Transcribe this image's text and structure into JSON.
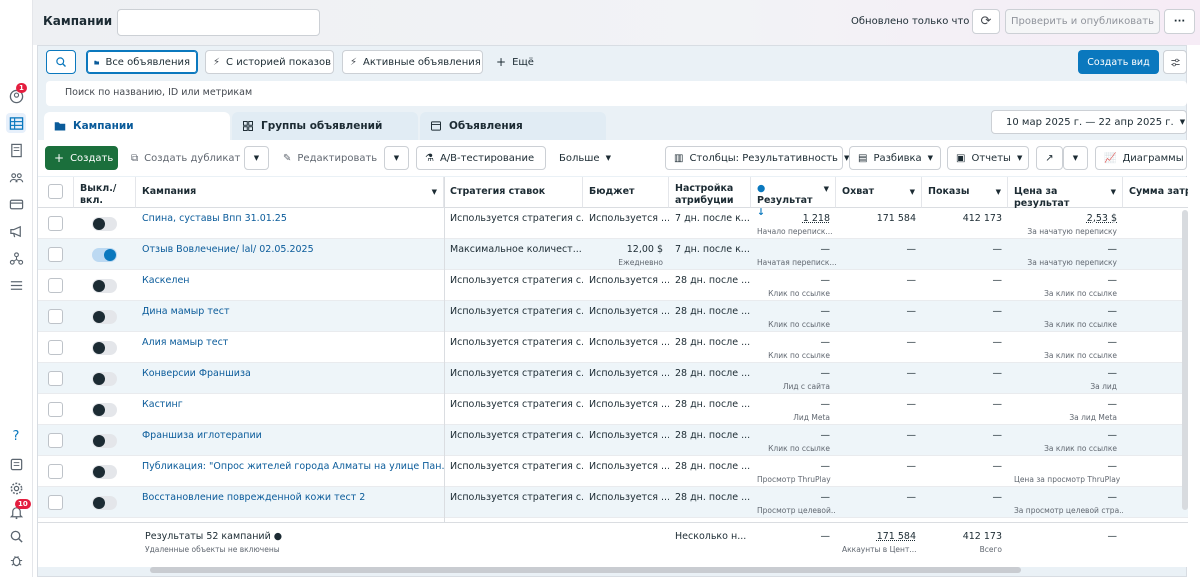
{
  "header": {
    "title": "Кампании",
    "updated": "Обновлено только что",
    "publish": "Проверить и опубликовать",
    "more": "···"
  },
  "views": {
    "all": "Все объявления",
    "history": "С историей показов",
    "active": "Активные объявления",
    "more": "Ещё",
    "create_view": "Создать вид"
  },
  "search": {
    "placeholder": "Поиск по названию, ID или метрикам"
  },
  "tabs": {
    "campaigns": "Кампании",
    "adsets": "Группы объявлений",
    "ads": "Объявления"
  },
  "date_range": "10 мар 2025 г. — 22 апр 2025 г.",
  "toolbar": {
    "create": "Создать",
    "duplicate": "Создать дубликат",
    "edit": "Редактировать",
    "ab": "A/B-тестирование",
    "more": "Больше",
    "columns": "Столбцы: Результативность",
    "breakdown": "Разбивка",
    "reports": "Отчеты",
    "charts": "Диаграммы"
  },
  "columns": {
    "toggle": "Выкл./ вкл.",
    "campaign": "Кампания",
    "bid": "Стратегия ставок",
    "budget": "Бюджет",
    "attribution": "Настройка атрибуции",
    "result": "Результат",
    "reach": "Охват",
    "impressions": "Показы",
    "cpr": "Цена за результат",
    "spent": "Сумма затра"
  },
  "rows": [
    {
      "on": false,
      "name": "Спина, суставы Впп 31.01.25",
      "bid": "Используется стратегия с...",
      "budget": "Используется ...",
      "budget_sub": "",
      "attr": "7 дн. после к...",
      "result": "1 218",
      "result_sub": "Начало переписк...",
      "reach": "171 584",
      "impr": "412 173",
      "cpr": "2,53 $",
      "cpr_sub": "За начатую переписку"
    },
    {
      "on": true,
      "name": "Отзыв Вовлечение/ lal/ 02.05.2025",
      "bid": "Максимальное количест...",
      "budget": "12,00 $",
      "budget_sub": "Ежедневно",
      "attr": "7 дн. после к...",
      "result": "—",
      "result_sub": "Начатая переписк...",
      "reach": "—",
      "impr": "—",
      "cpr": "—",
      "cpr_sub": "За начатую переписку"
    },
    {
      "on": false,
      "name": "Каскелен",
      "bid": "Используется стратегия с...",
      "budget": "Используется ...",
      "budget_sub": "",
      "attr": "28 дн. после ...",
      "result": "—",
      "result_sub": "Клик по ссылке",
      "reach": "—",
      "impr": "—",
      "cpr": "—",
      "cpr_sub": "За клик по ссылке"
    },
    {
      "on": false,
      "name": "Дина мамыр тест",
      "bid": "Используется стратегия с...",
      "budget": "Используется ...",
      "budget_sub": "",
      "attr": "28 дн. после ...",
      "result": "—",
      "result_sub": "Клик по ссылке",
      "reach": "—",
      "impr": "—",
      "cpr": "—",
      "cpr_sub": "За клик по ссылке"
    },
    {
      "on": false,
      "name": "Алия мамыр тест",
      "bid": "Используется стратегия с...",
      "budget": "Используется ...",
      "budget_sub": "",
      "attr": "28 дн. после ...",
      "result": "—",
      "result_sub": "Клик по ссылке",
      "reach": "—",
      "impr": "—",
      "cpr": "—",
      "cpr_sub": "За клик по ссылке"
    },
    {
      "on": false,
      "name": "Конверсии Франшиза",
      "bid": "Используется стратегия с...",
      "budget": "Используется ...",
      "budget_sub": "",
      "attr": "28 дн. после ...",
      "result": "—",
      "result_sub": "Лид с сайта",
      "reach": "—",
      "impr": "—",
      "cpr": "—",
      "cpr_sub": "За лид"
    },
    {
      "on": false,
      "name": "Кастинг",
      "bid": "Используется стратегия с...",
      "budget": "Используется ...",
      "budget_sub": "",
      "attr": "28 дн. после ...",
      "result": "—",
      "result_sub": "Лид Meta",
      "reach": "—",
      "impr": "—",
      "cpr": "—",
      "cpr_sub": "За лид Meta"
    },
    {
      "on": false,
      "name": "Франшиза иглотерапии",
      "bid": "Используется стратегия с...",
      "budget": "Используется ...",
      "budget_sub": "",
      "attr": "28 дн. после ...",
      "result": "—",
      "result_sub": "Клик по ссылке",
      "reach": "—",
      "impr": "—",
      "cpr": "—",
      "cpr_sub": "За клик по ссылке"
    },
    {
      "on": false,
      "name": "Публикация: \"Опрос жителей города Алматы на улице Пан...",
      "bid": "Используется стратегия с...",
      "budget": "Используется ...",
      "budget_sub": "",
      "attr": "28 дн. после ...",
      "result": "—",
      "result_sub": "Просмотр ThruPlay",
      "reach": "—",
      "impr": "—",
      "cpr": "—",
      "cpr_sub": "Цена за просмотр ThruPlay"
    },
    {
      "on": false,
      "name": "Восстановление поврежденной кожи тест 2",
      "bid": "Используется стратегия с...",
      "budget": "Используется ...",
      "budget_sub": "",
      "attr": "28 дн. после ...",
      "result": "—",
      "result_sub": "Просмотр целевой...",
      "reach": "—",
      "impr": "—",
      "cpr": "—",
      "cpr_sub": "За просмотр целевой стра..."
    }
  ],
  "footer": {
    "title": "Результаты 52 кампаний",
    "sub": "Удаленные объекты не включены",
    "attr": "Несколько н...",
    "result": "—",
    "reach": "171 584",
    "reach_sub": "Аккаунты в Цент...",
    "impr": "412 173",
    "impr_sub": "Всего",
    "cpr": "—"
  },
  "badges": {
    "notifications": "1",
    "alerts": "10"
  }
}
